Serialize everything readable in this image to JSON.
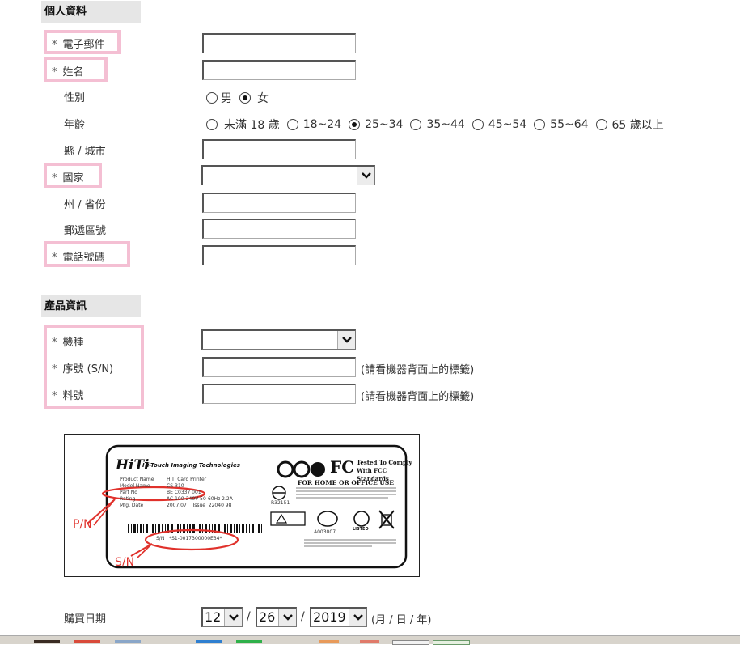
{
  "personal": {
    "section_title": "個人資料",
    "email_label": "電子郵件",
    "name_label": "姓名",
    "gender_label": "性別",
    "gender_options": [
      "男",
      "女"
    ],
    "age_label": "年齡",
    "age_options": [
      "未滿 18 歲",
      "18~24",
      "25~34",
      "35~44",
      "45~54",
      "55~64",
      "65 歲以上"
    ],
    "city_label": "縣 / 城市",
    "country_label": "國家",
    "state_label": "州 / 省份",
    "zip_label": "郵遞區號",
    "phone_label": "電話號碼",
    "required_mark": "*"
  },
  "product": {
    "section_title": "產品資訊",
    "model_label": "機種",
    "serial_label": "序號 (S/N)",
    "part_label": "料號",
    "serial_hint": "(請看機器背面上的標籤)",
    "part_hint": "(請看機器背面上的標籤)"
  },
  "device_label": {
    "brand": "Hi-Touch Imaging Technologies",
    "logo": "HiTi",
    "product_name_key": "Product Name",
    "product_name_val": "HiTi Card Printer",
    "model_name_key": "Model Name",
    "model_name_val": "CS-310",
    "part_no_key": "Part No",
    "part_no_val": "BE C0337 001",
    "rating_key": "Rating",
    "rating_val": "AC 100-240V 50-60Hz 2.2A",
    "mfg_key": "Mfg. Date",
    "mfg_val": "2007.07",
    "issue_key": "Issue",
    "issue_val": "22040 98",
    "sn_key": "S/N",
    "sn_val": "*S1-0017300000E34*",
    "fcc_title1": "Tested To Comply",
    "fcc_title2": "With FCC Standards",
    "fcc_home": "FOR HOME OR OFFICE USE",
    "reg_code": "R32151",
    "a_code": "A003007",
    "listed": "LISTED",
    "pn_callout": "P/N",
    "sn_callout": "S/N"
  },
  "purchase": {
    "label": "購買日期",
    "month": "12",
    "day": "26",
    "year": "2019",
    "separator": "/",
    "format_hint": "(月 / 日 / 年)"
  },
  "colors": {
    "required_box": "#f4bfd3",
    "section_bg": "#e6e6e6",
    "callout_red": "#e0312b"
  }
}
